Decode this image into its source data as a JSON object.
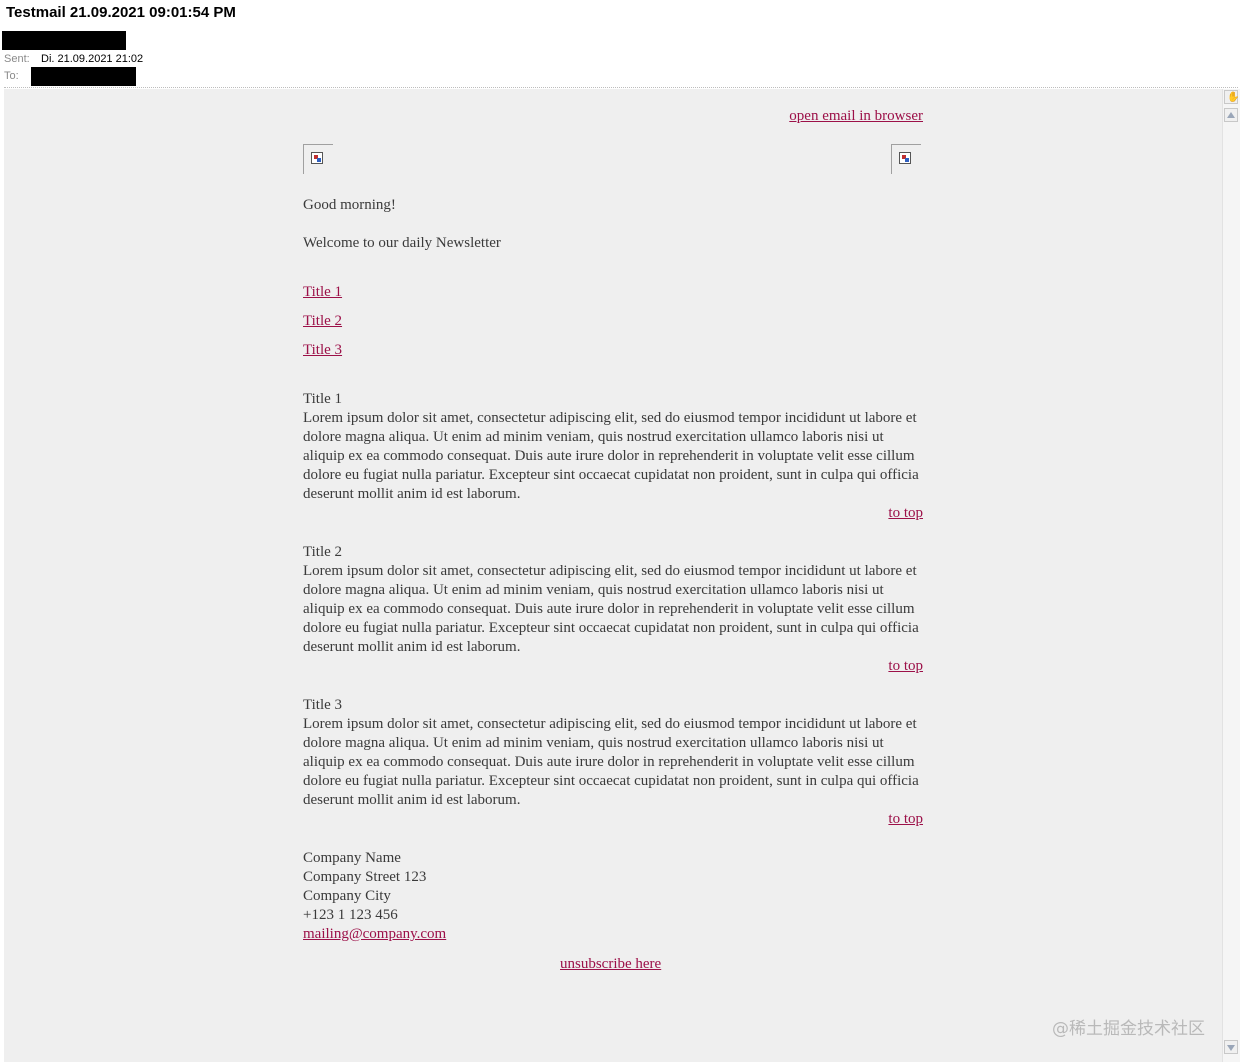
{
  "header": {
    "subject": "Testmail 21.09.2021 09:01:54 PM",
    "sent_label": "Sent:",
    "sent_value": "Di. 21.09.2021 21:02",
    "to_label": "To:"
  },
  "email": {
    "open_in_browser": "open email in browser",
    "greeting": "Good morning!",
    "welcome": "Welcome to our daily Newsletter",
    "toc": [
      "Title 1",
      "Title 2",
      "Title 3"
    ],
    "sections": [
      {
        "title": "Title 1",
        "body": "Lorem ipsum dolor sit amet, consectetur adipiscing elit, sed do eiusmod tempor incididunt ut labore et dolore magna aliqua. Ut enim ad minim veniam, quis nostrud exercitation ullamco laboris nisi ut aliquip ex ea commodo consequat. Duis aute irure dolor in reprehenderit in voluptate velit esse cillum dolore eu fugiat nulla pariatur. Excepteur sint occaecat cupidatat non proident, sunt in culpa qui officia deserunt mollit anim id est laborum.",
        "to_top": "to top"
      },
      {
        "title": "Title 2",
        "body": "Lorem ipsum dolor sit amet, consectetur adipiscing elit, sed do eiusmod tempor incididunt ut labore et dolore magna aliqua. Ut enim ad minim veniam, quis nostrud exercitation ullamco laboris nisi ut aliquip ex ea commodo consequat. Duis aute irure dolor in reprehenderit in voluptate velit esse cillum dolore eu fugiat nulla pariatur. Excepteur sint occaecat cupidatat non proident, sunt in culpa qui officia deserunt mollit anim id est laborum.",
        "to_top": "to top"
      },
      {
        "title": "Title 3",
        "body": "Lorem ipsum dolor sit amet, consectetur adipiscing elit, sed do eiusmod tempor incididunt ut labore et dolore magna aliqua. Ut enim ad minim veniam, quis nostrud exercitation ullamco laboris nisi ut aliquip ex ea commodo consequat. Duis aute irure dolor in reprehenderit in voluptate velit esse cillum dolore eu fugiat nulla pariatur. Excepteur sint occaecat cupidatat non proident, sunt in culpa qui officia deserunt mollit anim id est laborum.",
        "to_top": "to top"
      }
    ],
    "footer": {
      "company_name": "Company Name",
      "street": "Company Street 123",
      "city": "Company City",
      "phone": "+123 1 123 456",
      "email": "mailing@company.com"
    },
    "unsubscribe": "unsubscribe here"
  },
  "watermark": "@稀土掘金技术社区",
  "colors": {
    "link": "#9c1048",
    "text": "#3a3a3a",
    "background": "#efefef"
  },
  "icons": [
    "broken-image-icon",
    "scroll-up-icon",
    "scroll-down-icon",
    "hand-icon"
  ]
}
